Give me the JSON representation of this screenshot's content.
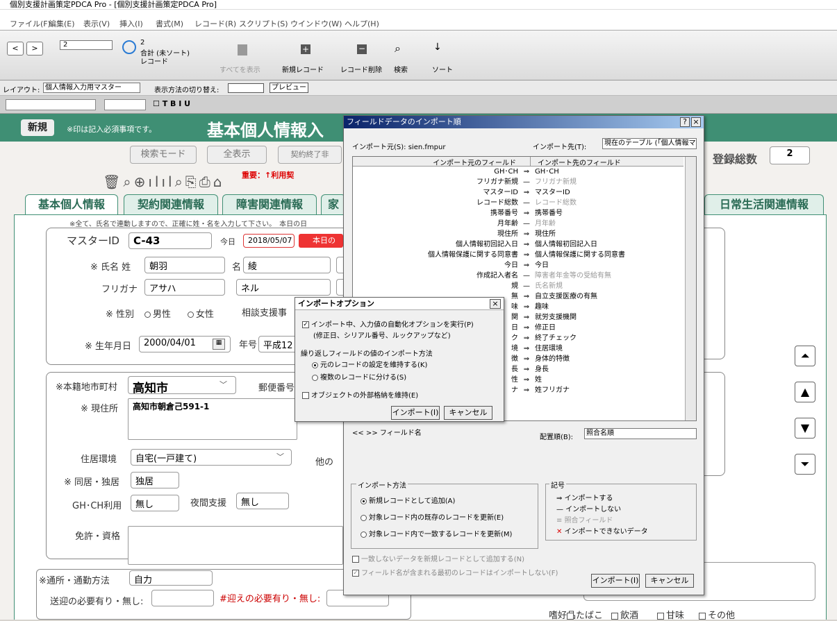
{
  "window": {
    "title": "個別支援計画策定PDCA Pro - [個別支援計画策定PDCA Pro]"
  },
  "menu": [
    "ファイル(F)",
    "編集(E)",
    "表示(V)",
    "挿入(I)",
    "書式(M)",
    "レコード(R)",
    "スクリプト(S)",
    "ウインドウ(W)",
    "ヘルプ(H)"
  ],
  "toolbar": {
    "record_num": "2",
    "total": "2",
    "total_label": "合計 (未ソート)",
    "record_label": "レコード",
    "show_all": "すべてを表示",
    "new_record": "新規レコード",
    "delete_record": "レコード削除",
    "search": "検索",
    "sort": "ソート"
  },
  "layoutbar": {
    "layout_label": "レイアウト:",
    "layout_value": "個人情報入力用マスター",
    "view_label": "表示方法の切り替え:",
    "preview": "プレビュー"
  },
  "header": {
    "new_btn": "新規",
    "note": "※印は記入必須事項です。",
    "title": "基本個人情報入"
  },
  "top": {
    "search_mode": "検索モード",
    "show_all": "全表示",
    "contract_end": "契約終了非",
    "warning": "重要：↑利用契",
    "total_label": "登録総数",
    "total_value": "2"
  },
  "tabs": [
    "基本個人情報",
    "契約関連情報",
    "障害関連情報",
    "家",
    "日常生活関連情報"
  ],
  "form": {
    "note": "※全て、氏名で連動しますので、正確に姓・名を入力して下さい。　本日の日",
    "master_label": "マスターID",
    "master_value": "C-43",
    "today_label": "今日",
    "today_value": "2018/05/07",
    "today_badge": "本日の",
    "name_label": "※ 氏名 姓",
    "last_name": "朝羽",
    "first_label": "名",
    "first_name": "綾",
    "furigana_label": "フリガナ",
    "furi_last": "アサハ",
    "furi_first": "ネル",
    "gender_label": "※ 性別",
    "male": "男性",
    "female": "女性",
    "counsel_label": "相談支援事",
    "birth_label": "※ 生年月日",
    "birth_value": "2000/04/01",
    "era_label": "年号",
    "era_value": "平成12",
    "honseki_label": "※本籍地市町村",
    "honseki_value": "高知市",
    "postal_label": "郵便番号",
    "address_label": "※ 現住所",
    "address_value": "高知市朝倉己591-1",
    "housing_label": "住居環境",
    "housing_value": "自宅(一戸建て)",
    "other_label": "他の",
    "live_label": "※ 同居・独居",
    "live_value": "独居",
    "gh_label": "GH･CH利用",
    "gh_value": "無し",
    "night_label": "夜間支援",
    "night_value": "無し",
    "license_label": "免許・資格",
    "commute_label": "※通所・通勤方法",
    "commute_value": "自力",
    "pickup_label": "送迎の必要有り・無し:",
    "pickup2_label": "#迎えの必要有り・無し:",
    "hobby_label": "嗜好品",
    "hobby_opts": [
      "たばこ",
      "飲酒",
      "甘味",
      "その他"
    ]
  },
  "import_dialog": {
    "title": "フィールドデータのインポート順",
    "help": "?",
    "close": "×",
    "source_label": "インポート元(S):",
    "source_value": "sien.fmpur",
    "dest_label": "インポート先(T):",
    "dest_value": "現在のテーブル (「個人情報マス",
    "col_src": "インポート元のフィールド",
    "col_dst": "インポート先のフィールド",
    "rows": [
      {
        "s": "GH･CH",
        "a": "⇒",
        "d": "GH･CH"
      },
      {
        "s": "フリガナ新規",
        "a": "—",
        "d": "フリガナ新規"
      },
      {
        "s": "マスターID",
        "a": "⇒",
        "d": "マスターID"
      },
      {
        "s": "レコード総数",
        "a": "—",
        "d": "レコード総数"
      },
      {
        "s": "携帯番号",
        "a": "⇒",
        "d": "携帯番号"
      },
      {
        "s": "月年齢",
        "a": "—",
        "d": "月年齢"
      },
      {
        "s": "現住所",
        "a": "⇒",
        "d": "現住所"
      },
      {
        "s": "個人情報初回記入日",
        "a": "⇒",
        "d": "個人情報初回記入日"
      },
      {
        "s": "個人情報保護に関する同意書",
        "a": "⇒",
        "d": "個人情報保護に関する同意書"
      },
      {
        "s": "今日",
        "a": "⇒",
        "d": "今日"
      },
      {
        "s": "作成記入者名",
        "a": "—",
        "d": "障害者年金等の受給有無"
      },
      {
        "s": "規",
        "a": "—",
        "d": "氏名新規"
      },
      {
        "s": "無",
        "a": "⇒",
        "d": "自立支援医療の有無"
      },
      {
        "s": "味",
        "a": "⇒",
        "d": "趣味"
      },
      {
        "s": "関",
        "a": "⇒",
        "d": "就労支援機関"
      },
      {
        "s": "日",
        "a": "⇒",
        "d": "修正日"
      },
      {
        "s": "ク",
        "a": "⇒",
        "d": "終了チェック"
      },
      {
        "s": "境",
        "a": "⇒",
        "d": "住居環境"
      },
      {
        "s": "徴",
        "a": "⇒",
        "d": "身体的特徴"
      },
      {
        "s": "長",
        "a": "⇒",
        "d": "身長"
      },
      {
        "s": "性",
        "a": "⇒",
        "d": "姓"
      },
      {
        "s": "ナ",
        "a": "⇒",
        "d": "姓フリガナ"
      }
    ],
    "nav": "<< >>",
    "field_name": "フィールド名",
    "order_label": "配置順(B):",
    "order_value": "照合名順",
    "method_title": "インポート方法",
    "m1": "新規レコードとして追加(A)",
    "m2": "対象レコード内の既存のレコードを更新(E)",
    "m3": "対象レコード内で一致するレコードを更新(M)",
    "legend_title": "記号",
    "l1": "インポートする",
    "l2": "インポートしない",
    "l3": "照合フィールド",
    "l4": "インポートできないデータ",
    "c1": "一致しないデータを新規レコードとして追加する(N)",
    "c2": "フィールド名が含まれる最初のレコードはインポートしない(F)",
    "import_btn": "インポート(I)",
    "cancel_btn": "キャンセル"
  },
  "options_dialog": {
    "title": "インポートオプション",
    "close": "×",
    "auto": "インポート中、入力値の自動化オプションを実行(P)",
    "auto_sub": "(修正日、シリアル番号、ルックアップなど)",
    "repeat_label": "繰り返しフィールドの値のインポート方法",
    "r1": "元のレコードの設定を維持する(K)",
    "r2": "複数のレコードに分ける(S)",
    "ext": "オブジェクトの外部格納を維持(E)",
    "import_btn": "インポート(I)",
    "cancel_btn": "キャンセル"
  }
}
